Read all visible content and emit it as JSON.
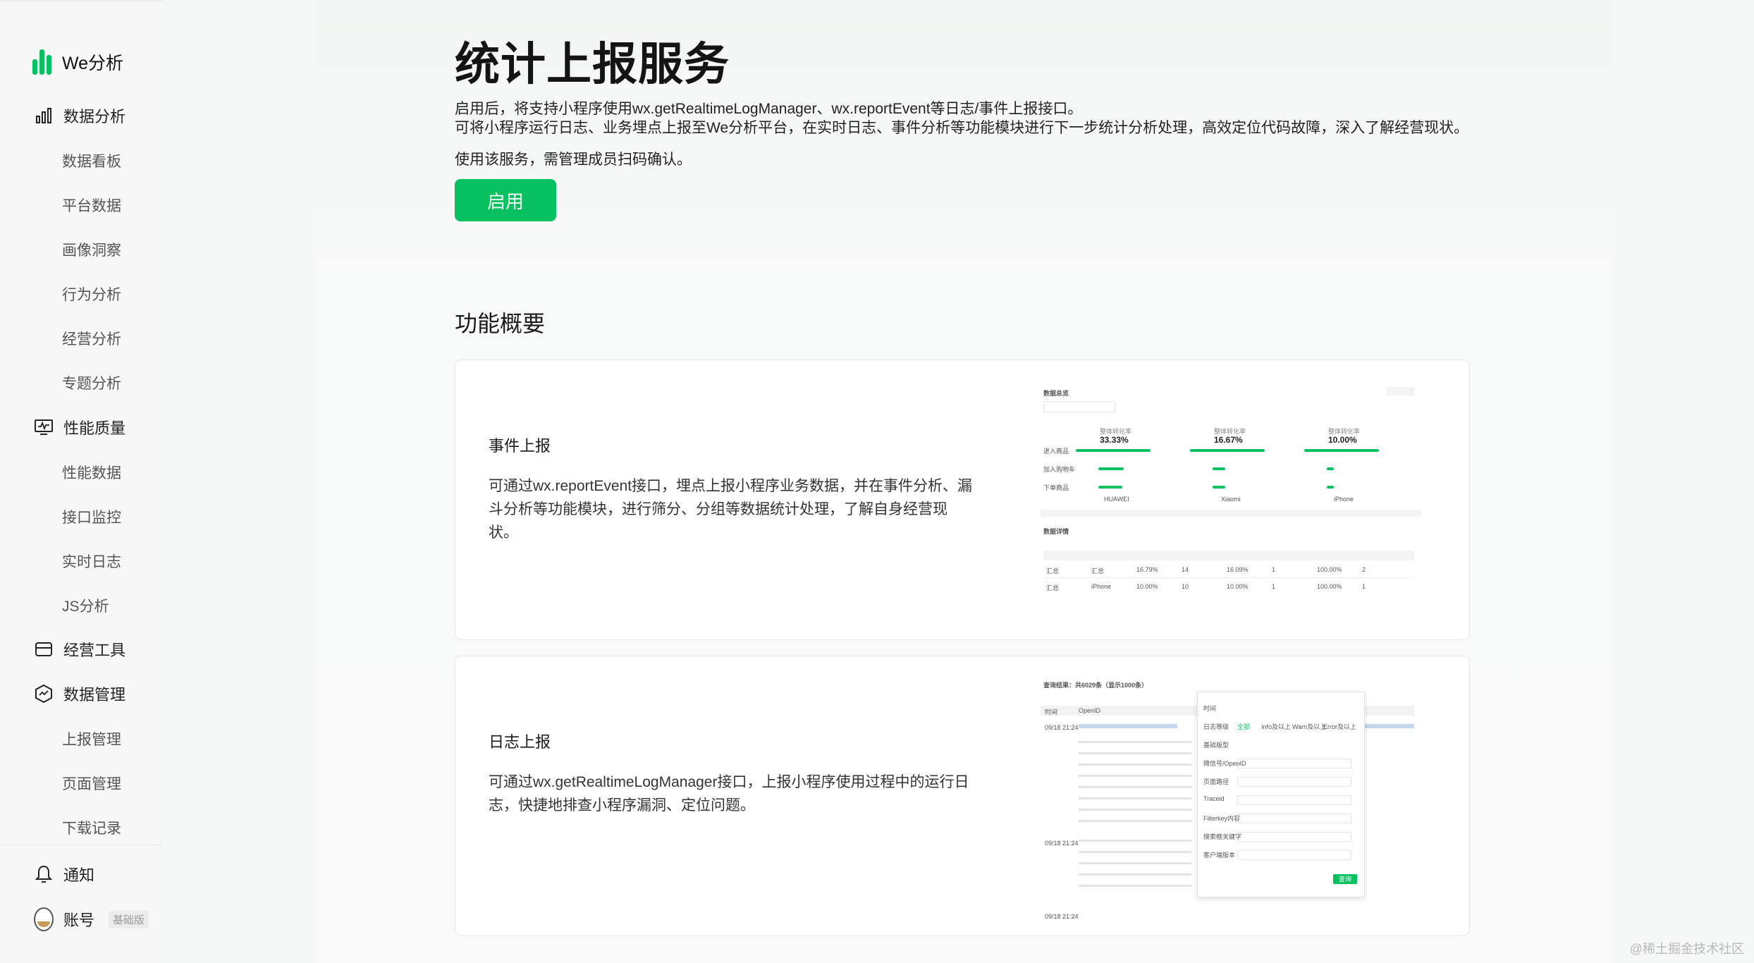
{
  "sidebar": {
    "brand": "We分析",
    "groups": [
      {
        "label": "数据分析",
        "icon": "bar-chart-icon",
        "items": [
          "数据看板",
          "平台数据",
          "画像洞察",
          "行为分析",
          "经营分析",
          "专题分析"
        ]
      },
      {
        "label": "性能质量",
        "icon": "monitor-icon",
        "items": [
          "性能数据",
          "接口监控",
          "实时日志",
          "JS分析"
        ]
      },
      {
        "label": "经营工具",
        "icon": "store-icon",
        "items": []
      },
      {
        "label": "数据管理",
        "icon": "data-manage-icon",
        "items": [
          "上报管理",
          "页面管理",
          "下载记录"
        ]
      }
    ],
    "notify": "通知",
    "account": "账号",
    "account_badge": "基础版"
  },
  "main": {
    "title": "统计上报服务",
    "desc_line1": "启用后，将支持小程序使用wx.getRealtimeLogManager、wx.reportEvent等日志/事件上报接口。",
    "desc_line2": "可将小程序运行日志、业务埋点上报至We分析平台，在实时日志、事件分析等功能模块进行下一步统计分析处理，高效定位代码故障，深入了解经营现状。",
    "desc_line3": "使用该服务，需管理成员扫码确认。",
    "enable_button": "启用",
    "section_title": "功能概要",
    "cards": [
      {
        "title": "事件上报",
        "desc": "可通过wx.reportEvent接口，埋点上报小程序业务数据，并在事件分析、漏斗分析等功能模块，进行筛分、分组等数据统计处理，了解自身经营现状。"
      },
      {
        "title": "日志上报",
        "desc": "可通过wx.getRealtimeLogManager接口，上报小程序使用过程中的运行日志，快捷地排查小程序漏洞、定位问题。"
      }
    ]
  },
  "preview1": {
    "header": "数据总览",
    "metrics": [
      "33.33%",
      "16.67%",
      "10.00%"
    ],
    "metric_label": "整体转化率",
    "groups": [
      "HUAWEI",
      "Xiaomi",
      "iPhone"
    ],
    "rows": [
      "进入商品",
      "加入购物车",
      "下单商品"
    ],
    "detail_header": "数据详情",
    "table_rows": [
      [
        "汇总",
        "汇总",
        "16.79%",
        "14",
        "16.09%",
        "1",
        "100.00%",
        "2"
      ],
      [
        "汇总",
        "iPhone",
        "10.00%",
        "10",
        "10.00%",
        "1",
        "100.00%",
        "1"
      ]
    ]
  },
  "preview2": {
    "header": "查询结果：共6029条（显示1000条）",
    "col_time": "时间",
    "col_openid": "OpenID",
    "times": [
      "09/18 21:24",
      "09/18 21:24",
      "09/18 21:24"
    ],
    "filter_labels": [
      "时间",
      "日志等级",
      "基础版型",
      "微信号/OpenID",
      "页面路径",
      "Traceid",
      "Filterkey内容",
      "搜索框关键字",
      "客户端版本"
    ],
    "filter_button": "查询",
    "level_options": [
      "全部",
      "Info及以上",
      "Warn及以上",
      "Error及以上"
    ]
  },
  "watermark": "@稀土掘金技术社区"
}
